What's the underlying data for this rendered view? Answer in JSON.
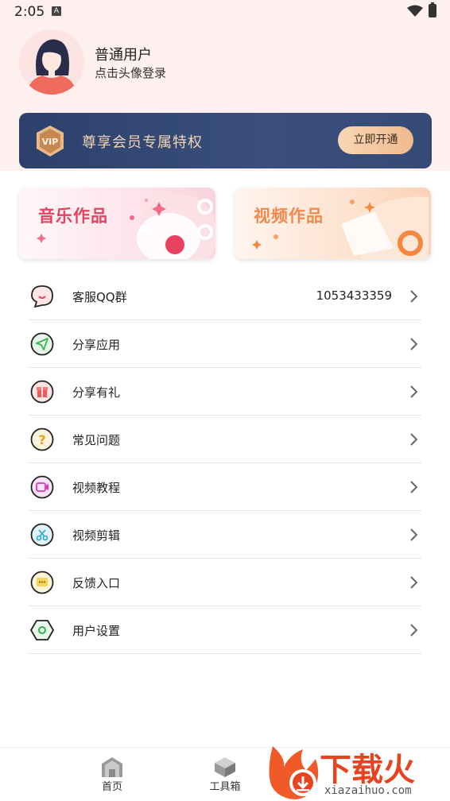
{
  "status_bar": {
    "time": "2:05",
    "notification_icon": "A"
  },
  "profile": {
    "name": "普通用户",
    "subtitle": "点击头像登录"
  },
  "vip": {
    "badge": "VIP",
    "text": "尊享会员专属特权",
    "button": "立即开通"
  },
  "cards": [
    {
      "title": "音乐作品",
      "color": "#e8405f"
    },
    {
      "title": "视频作品",
      "color": "#f0894a"
    }
  ],
  "menu": [
    {
      "label": "客服QQ群",
      "value": "1053433359",
      "icon": "chat-bubble-icon"
    },
    {
      "label": "分享应用",
      "value": "",
      "icon": "paper-plane-icon"
    },
    {
      "label": "分享有礼",
      "value": "",
      "icon": "gift-icon"
    },
    {
      "label": "常见问题",
      "value": "",
      "icon": "question-icon"
    },
    {
      "label": "视频教程",
      "value": "",
      "icon": "video-icon"
    },
    {
      "label": "视频剪辑",
      "value": "",
      "icon": "scissors-icon"
    },
    {
      "label": "反馈入口",
      "value": "",
      "icon": "feedback-icon"
    },
    {
      "label": "用户设置",
      "value": "",
      "icon": "settings-hexagon-icon"
    }
  ],
  "bottom_nav": [
    {
      "label": "首页",
      "icon": "home-icon"
    },
    {
      "label": "工具箱",
      "icon": "toolbox-icon"
    }
  ],
  "watermark": {
    "title": "下载火",
    "url": "xiazaihuo.com"
  },
  "colors": {
    "accent": "#e8405f",
    "vip_bg": "#2b416b",
    "vip_gold": "#f3d5b5"
  }
}
